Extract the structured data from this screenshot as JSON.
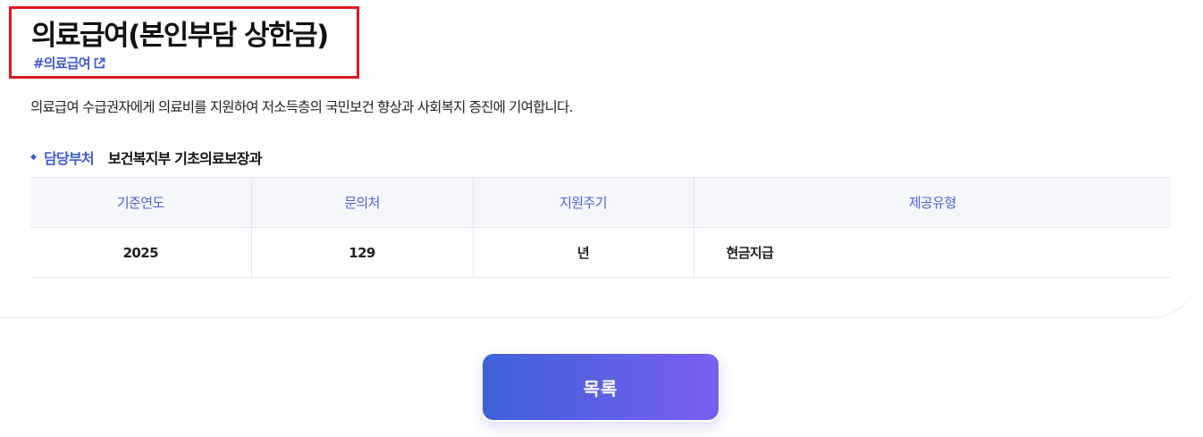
{
  "header": {
    "title": "의료급여(본인부담 상한금)",
    "hashtag": "#의료급여"
  },
  "description": "의료급여 수급권자에게 의료비를 지원하여 저소득층의 국민보건 향상과 사회복지 증진에 기여합니다.",
  "department": {
    "label": "담당부처",
    "value": "보건복지부 기초의료보장과"
  },
  "info_table": {
    "headers": [
      "기준연도",
      "문의처",
      "지원주기",
      "제공유형"
    ],
    "row": [
      "2025",
      "129",
      "년",
      "현금지급"
    ]
  },
  "actions": {
    "list_button": "목록"
  },
  "colors": {
    "accent": "#3d5bd5",
    "highlight_border": "#e0191e",
    "button_gradient_start": "#3e62d9",
    "button_gradient_end": "#7a5ef0"
  },
  "icons": {
    "hashtag_link": "external-link-icon",
    "department_bullet": "diamond-bullet-icon"
  }
}
